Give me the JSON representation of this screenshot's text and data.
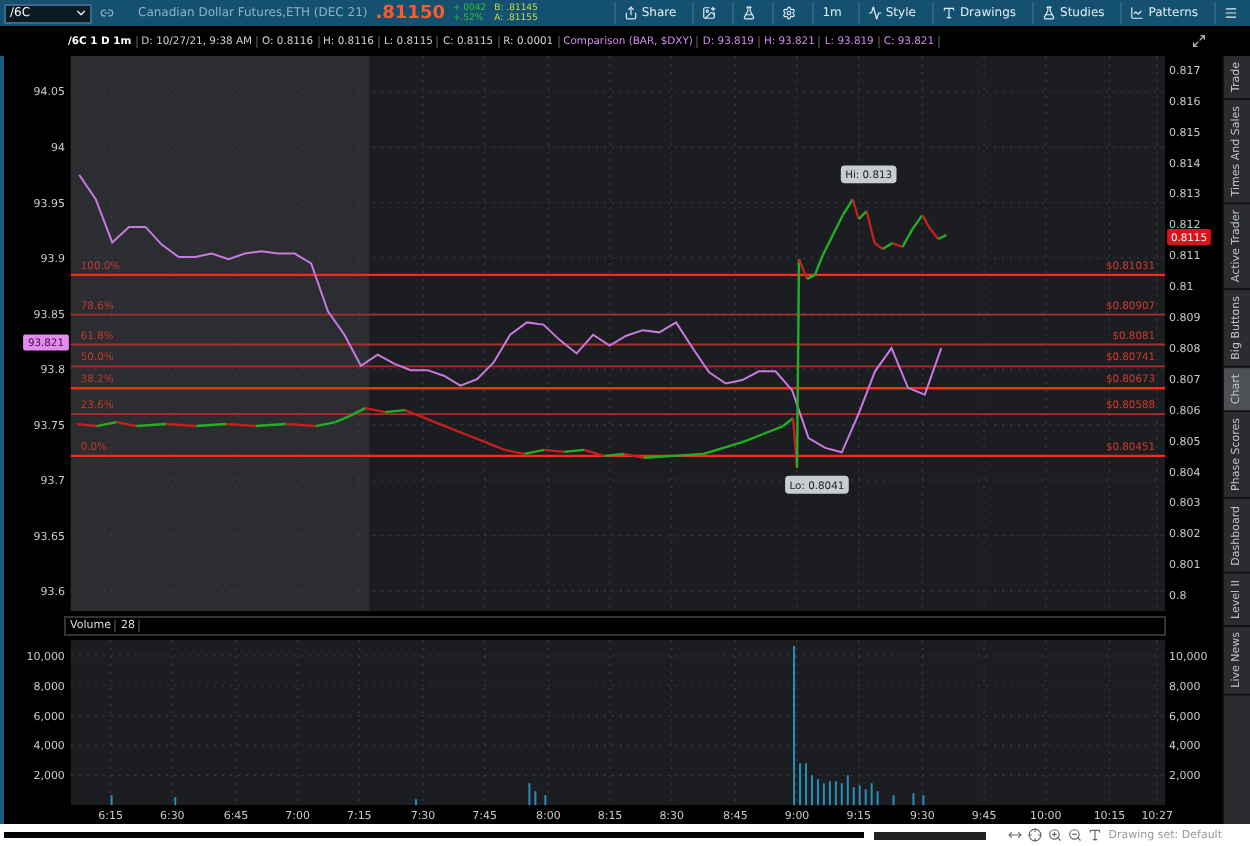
{
  "toolbar": {
    "symbol": "/6C",
    "description": "Canadian Dollar Futures,ETH (DEC 21)",
    "last_price": ".81150",
    "change": "+.0042",
    "change_pct": "+.52%",
    "bid": "B: .81145",
    "ask": "A: .81155",
    "buttons": [
      {
        "kind": "share",
        "label": "Share"
      },
      {
        "kind": "snapshot"
      },
      {
        "kind": "flask"
      },
      {
        "kind": "settings"
      },
      {
        "kind": "timeframe",
        "label": "1m"
      },
      {
        "kind": "style",
        "label": "Style"
      },
      {
        "kind": "drawings",
        "label": "Drawings"
      },
      {
        "kind": "studies",
        "label": "Studies"
      },
      {
        "kind": "patterns",
        "label": "Patterns"
      },
      {
        "kind": "menu"
      }
    ]
  },
  "info_bar": {
    "title": "/6C 1 D 1m",
    "items": [
      {
        "kind": "main",
        "text": "D: 10/27/21, 9:38 AM"
      },
      {
        "kind": "main",
        "text": "O: 0.8116"
      },
      {
        "kind": "main",
        "text": "H: 0.8116"
      },
      {
        "kind": "main",
        "text": "L: 0.8115"
      },
      {
        "kind": "main",
        "text": "C: 0.8115"
      },
      {
        "kind": "main",
        "text": "R: 0.0001"
      },
      {
        "kind": "comparison",
        "text": "Comparison (BAR, $DXY)"
      },
      {
        "kind": "comparison",
        "text": "D: 93.819"
      },
      {
        "kind": "comparison",
        "text": "H: 93.821"
      },
      {
        "kind": "comparison",
        "text": "L: 93.819"
      },
      {
        "kind": "comparison",
        "text": "C: 93.821"
      }
    ]
  },
  "price_chart": {
    "comparison": {
      "chart_data": {
        "type": "line",
        "categories": [
          null,
          null,
          null,
          null,
          null,
          null,
          null,
          null,
          null,
          null,
          null,
          null,
          null,
          null,
          null,
          null,
          null,
          null,
          null,
          null,
          null,
          null,
          null,
          null,
          null,
          null,
          null,
          null,
          null,
          null,
          null,
          null,
          null,
          null,
          null,
          null,
          null,
          null,
          null,
          null,
          null,
          null,
          null,
          null,
          null,
          null,
          null,
          null,
          null,
          null,
          null,
          null,
          null,
          null,
          null,
          null,
          null,
          null,
          null,
          null,
          null,
          null,
          null,
          null,
          null,
          null
        ],
        "series": [
          {
            "color": "#c77ae0",
            "values": [
              93.975,
              93.953,
              93.914,
              93.928,
              93.928,
              93.912,
              93.901,
              93.901,
              93.904,
              93.899,
              93.904,
              93.906,
              93.904,
              93.904,
              93.895,
              93.852,
              93.831,
              93.803,
              93.813,
              93.805,
              93.799,
              93.799,
              93.794,
              93.785,
              93.791,
              93.806,
              93.831,
              93.842,
              93.84,
              93.826,
              93.814,
              93.831,
              93.821,
              93.83,
              93.835,
              93.833,
              93.842,
              93.819,
              93.797,
              93.787,
              93.79,
              93.798,
              93.798,
              93.781,
              93.738,
              93.729,
              93.725,
              93.759,
              93.798,
              93.819,
              93.783,
              93.777,
              93.819,
              null,
              null,
              null,
              null,
              null,
              null,
              null,
              null,
              null,
              null,
              null,
              null,
              null
            ]
          }
        ],
        "ylim": [
          93.582,
          94.082
        ],
        "yticks": [
          {
            "value": 94.05,
            "label": "94.05"
          },
          {
            "value": 94,
            "label": "94"
          },
          {
            "value": 93.95,
            "label": "93.95"
          },
          {
            "value": 93.9,
            "label": "93.9"
          },
          {
            "value": 93.85,
            "label": "93.85"
          },
          {
            "value": 93.8,
            "label": "93.8"
          },
          {
            "value": 93.75,
            "label": "93.75"
          },
          {
            "value": 93.7,
            "label": "93.7"
          },
          {
            "value": 93.65,
            "label": "93.65"
          },
          {
            "value": 93.6,
            "label": "93.6"
          }
        ]
      }
    },
    "right_axis": [
      "0.817",
      "0.816",
      "0.815",
      "0.814",
      "0.813",
      "0.812",
      "0.811",
      "0.81",
      "0.809",
      "0.808",
      "0.807",
      "0.806",
      "0.805",
      "0.804",
      "0.803",
      "0.802",
      "0.801",
      "0.8"
    ],
    "fib_levels": [
      {
        "percent": "100.0%",
        "price": "$0.81031"
      },
      {
        "percent": "78.6%",
        "price": "$0.80907"
      },
      {
        "percent": "61.8%",
        "price": "$0.8081"
      },
      {
        "percent": "50.0%",
        "price": "$0.80741"
      },
      {
        "percent": "38.2%",
        "price": "$0.80673"
      },
      {
        "percent": "23.6%",
        "price": "$0.80588"
      },
      {
        "percent": "0.0%",
        "price": "$0.80451"
      }
    ],
    "hi_label": "Hi: 0.813",
    "lo_label": "Lo: 0.8041",
    "comparison_tag": "93.821",
    "price_tag": "0.8115"
  },
  "volume": {
    "title": "Volume",
    "value": "28",
    "left_axis": [
      "10,000",
      "8,000",
      "6,000",
      "4,000",
      "2,000"
    ],
    "right_axis": [
      "10,000",
      "8,000",
      "6,000",
      "4,000",
      "2,000"
    ]
  },
  "time_axis": [
    "6:15",
    "6:30",
    "6:45",
    "7:00",
    "7:15",
    "7:30",
    "7:45",
    "8:00",
    "8:15",
    "8:30",
    "8:45",
    "9:00",
    "9:15",
    "9:30",
    "9:45",
    "10:00",
    "10:15",
    "10:27"
  ],
  "sidebar_tabs": [
    {
      "label": "Trade",
      "selected": false
    },
    {
      "label": "Times And Sales",
      "selected": false
    },
    {
      "label": "Active Trader",
      "selected": false
    },
    {
      "label": "Big Buttons",
      "selected": false
    },
    {
      "label": "Chart",
      "selected": true
    },
    {
      "label": "Phase Scores",
      "selected": false
    },
    {
      "label": "Dashboard",
      "selected": false
    },
    {
      "label": "Level II",
      "selected": false
    },
    {
      "label": "Live News",
      "selected": false
    }
  ],
  "status": {
    "drawing_set": "Drawing set: Default"
  }
}
